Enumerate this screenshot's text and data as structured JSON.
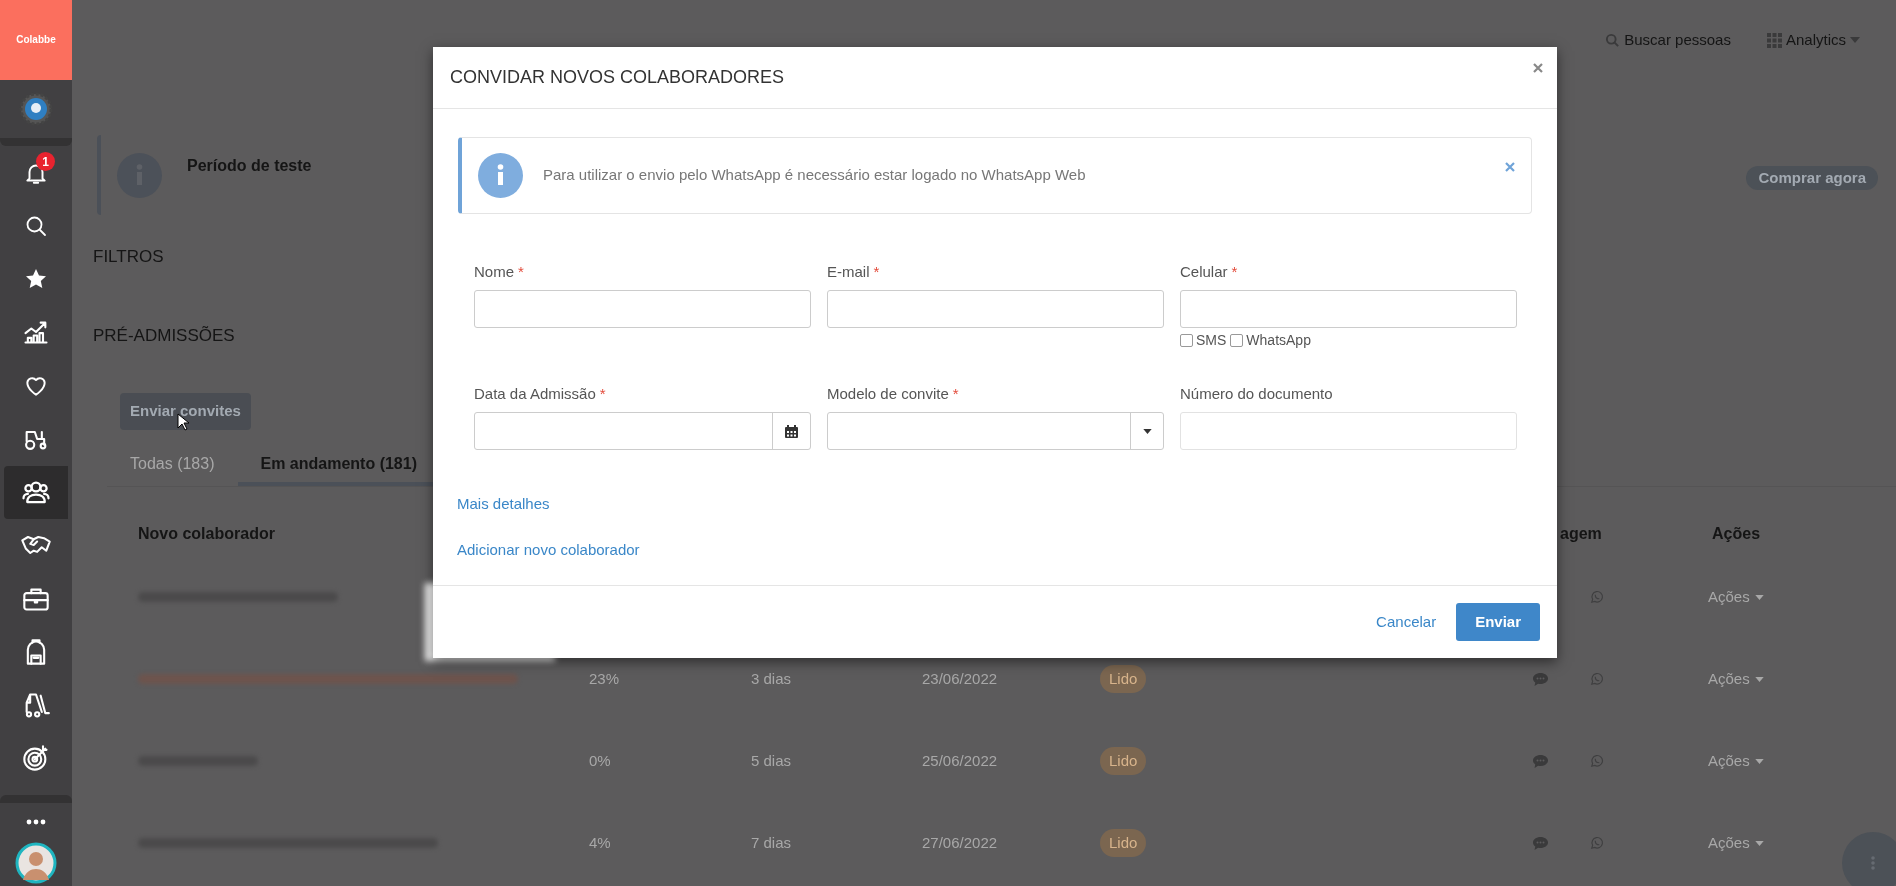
{
  "sidebar": {
    "logo": "Colabbe",
    "items": [
      {
        "kind": "gear",
        "selected": false
      },
      {
        "kind": "bell",
        "badge": "1",
        "selected": false
      },
      {
        "kind": "search",
        "selected": false
      },
      {
        "kind": "star",
        "selected": false
      },
      {
        "kind": "chart",
        "selected": false
      },
      {
        "kind": "heart",
        "selected": false
      },
      {
        "kind": "tractor",
        "selected": false
      },
      {
        "kind": "people",
        "selected": true
      },
      {
        "kind": "handshake",
        "selected": false
      },
      {
        "kind": "briefcase",
        "selected": false
      },
      {
        "kind": "backpack",
        "selected": false
      },
      {
        "kind": "forklift",
        "selected": false
      },
      {
        "kind": "target",
        "selected": false
      },
      {
        "kind": "more",
        "selected": false
      },
      {
        "kind": "avatar",
        "selected": false
      }
    ]
  },
  "top_bar": {
    "search_label": "Buscar pessoas",
    "menu_label": "Analytics"
  },
  "trial_notice": {
    "title": "Período de teste",
    "button": "Comprar agora"
  },
  "sections": [
    "FILTROS",
    "PRÉ-ADMISSÕES"
  ],
  "send_button": "Enviar convites",
  "tabs": [
    {
      "label": "Todas (183)",
      "selected": false
    },
    {
      "label": "Em andamento (181)",
      "selected": true
    }
  ],
  "table": {
    "columns": [
      "Novo colaborador",
      "agem",
      "Ações"
    ],
    "rows": [
      {
        "actions": "Ações"
      },
      {
        "progress": "23%",
        "days": "3 dias",
        "date": "23/06/2022",
        "status": "Lido",
        "actions": "Ações"
      },
      {
        "progress": "0%",
        "days": "5 dias",
        "date": "25/06/2022",
        "status": "Lido",
        "actions": "Ações"
      },
      {
        "progress": "4%",
        "days": "7 dias",
        "date": "27/06/2022",
        "status": "Lido",
        "actions": "Ações"
      }
    ]
  },
  "modal": {
    "title": "CONVIDAR NOVOS COLABORADORES",
    "alert": "Para utilizar o envio pelo WhatsApp é necessário estar logado no WhatsApp Web",
    "fields": [
      {
        "kind": "text",
        "label": "Nome",
        "required_mark": "*"
      },
      {
        "kind": "text",
        "label": "E-mail",
        "required_mark": "*"
      },
      {
        "kind": "phone",
        "label": "Celular",
        "required_mark": "*",
        "options": [
          {
            "label": "SMS",
            "checked": false
          },
          {
            "label": "WhatsApp",
            "checked": false
          }
        ]
      },
      {
        "kind": "date",
        "label": "Data da Admissão",
        "required_mark": "*"
      },
      {
        "kind": "select",
        "label": "Modelo de convite",
        "required_mark": "*"
      },
      {
        "kind": "text",
        "label": "Número do documento"
      }
    ],
    "links": [
      "Mais detalhes",
      "Adicionar novo colaborador"
    ],
    "cancel": "Cancelar",
    "submit": "Enviar"
  }
}
